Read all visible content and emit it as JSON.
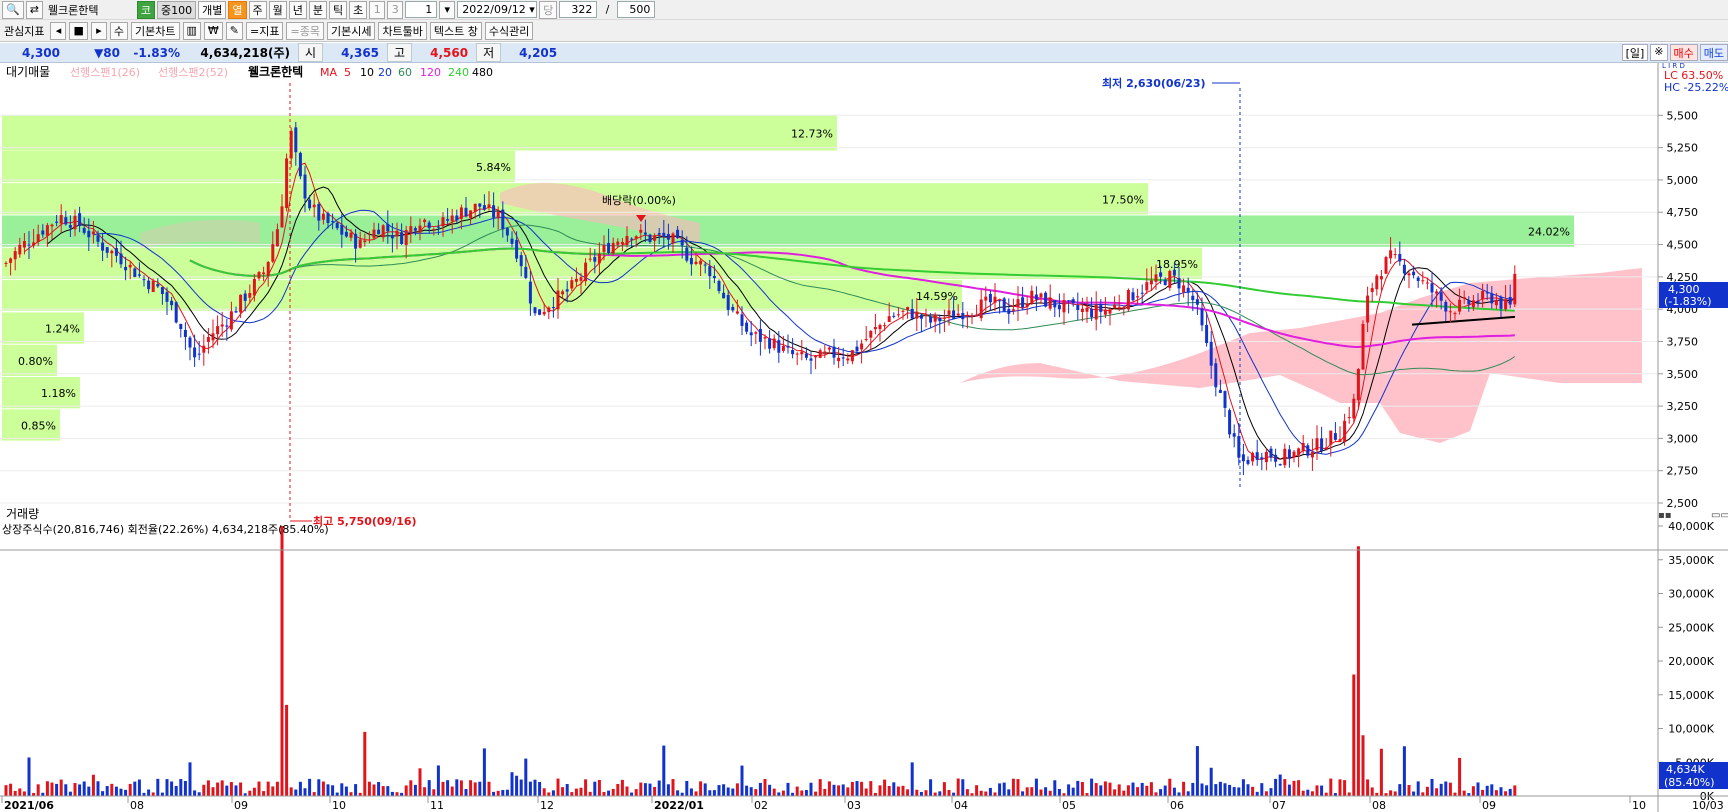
{
  "toolbar": {
    "stock_name": "웰크론한텍",
    "market_badge": "코",
    "index_badge": "중100",
    "btn_individual": "개별",
    "periods": [
      "열",
      "주",
      "월",
      "년",
      "분",
      "틱",
      "초"
    ],
    "interval_a": "1",
    "interval_b": "3",
    "interval_value": "1",
    "date": "2022/09/12",
    "dang": "당",
    "count": "322",
    "total": "500"
  },
  "toolbar2": {
    "indicators": "관심지표",
    "basic_chart": "기본차트",
    "indicator": "=지표",
    "item": "=종목",
    "basic_quote": "기본시세",
    "chart_toolbar": "차트툴바",
    "text_window": "텍스트 창",
    "formula": "수식관리"
  },
  "quote": {
    "price": "4,300",
    "change": "▼80",
    "change_pct": "-1.83%",
    "volume": "4,634,218(주)",
    "open_label": "시",
    "open": "4,365",
    "high_label": "고",
    "high": "4,560",
    "low_label": "저",
    "low": "4,205",
    "period_tag": "[일]",
    "settings": "※",
    "buy": "매수",
    "sell": "매도"
  },
  "legend": {
    "vp": "대기매물",
    "span1": "선행스팬1(26)",
    "span2": "선행스팬2(52)",
    "stock": "웰크론한텍",
    "ma_label": "MA",
    "ma": [
      {
        "p": "5",
        "c": "#e2141b"
      },
      {
        "p": "10",
        "c": "#000000"
      },
      {
        "p": "20",
        "c": "#1133cc"
      },
      {
        "p": "60",
        "c": "#2e8b57"
      },
      {
        "p": "120",
        "c": "#e01ee0"
      },
      {
        "p": "240",
        "c": "#33cc33"
      },
      {
        "p": "480",
        "c": "#000000"
      }
    ]
  },
  "volume_legend": {
    "title": "거래량",
    "info": "상장주식수(20,816,746) 회전율(22.26%) 4,634,218주(85.40%)"
  },
  "annotations": {
    "lowest": "최저 2,630(06/23)",
    "highest": "최고 5,750(09/16)",
    "dividend": "배당락(0.00%)"
  },
  "price_tag": {
    "price": "4,300",
    "pct": "(-1.83%)"
  },
  "vol_tag": {
    "value": "4,634K",
    "pct": "(85.40%)"
  },
  "lchc": {
    "lc": "LC  63.50%",
    "hc": "HC -25.22%"
  },
  "colors": {
    "up": "#e2141b",
    "down": "#1133cc",
    "profile": "#ccff99",
    "profile_hi": "#99f099",
    "cloud": "#ffb6c1"
  },
  "chart_data": {
    "type": "candlestick",
    "price_ylim": [
      2500,
      5750
    ],
    "price_ticks": [
      "5,500",
      "5,250",
      "5,000",
      "4,750",
      "4,500",
      "4,250",
      "4,000",
      "3,750",
      "3,500",
      "3,250",
      "3,000",
      "2,750",
      "2,500"
    ],
    "volume_ticks": [
      "40,000K",
      "35,000K",
      "30,000K",
      "25,000K",
      "20,000K",
      "15,000K",
      "10,000K",
      "5,000K",
      "0K"
    ],
    "x_labels": [
      "2021/06",
      "08",
      "09",
      "10",
      "11",
      "12",
      "2022/01",
      "02",
      "03",
      "04",
      "05",
      "06",
      "07",
      "08",
      "09",
      "10",
      "10/03"
    ],
    "volume_profile": [
      {
        "low": 5220,
        "high": 5500,
        "label": "12.73%"
      },
      {
        "low": 4975,
        "high": 5225,
        "label": "5.84%"
      },
      {
        "low": 4725,
        "high": 4975,
        "label": "17.50%"
      },
      {
        "low": 4475,
        "high": 4725,
        "label": "24.02%"
      },
      {
        "low": 4225,
        "high": 4475,
        "label": "18.95%"
      },
      {
        "low": 3980,
        "high": 4225,
        "label": "14.59%"
      },
      {
        "low": 3725,
        "high": 3975,
        "label": "1.24%"
      },
      {
        "low": 3475,
        "high": 3725,
        "label": "0.80%"
      },
      {
        "low": 3225,
        "high": 3475,
        "label": "1.18%"
      },
      {
        "low": 2975,
        "high": 3225,
        "label": "0.85%"
      }
    ]
  }
}
